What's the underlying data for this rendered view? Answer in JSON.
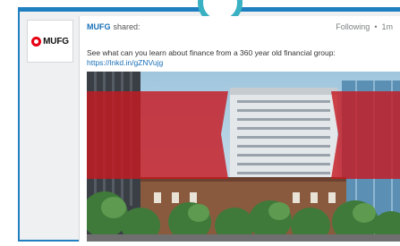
{
  "logo": {
    "icon": "mufg-logo-icon",
    "wordmark": "MUFG"
  },
  "post": {
    "author": "MUFG",
    "action": "shared:",
    "follow_status": "Following",
    "separator": "•",
    "time": "1m",
    "text": "See what can you learn about finance from a 360 year old financial group:",
    "link": "https://lnkd.in/gZNVujg"
  },
  "image": {
    "description_icon": "building-photo-icon"
  },
  "colors": {
    "accent": "#1e7fc1",
    "ring": "#39b1c2",
    "brand_red": "#e60012",
    "link": "#1a70b8"
  }
}
